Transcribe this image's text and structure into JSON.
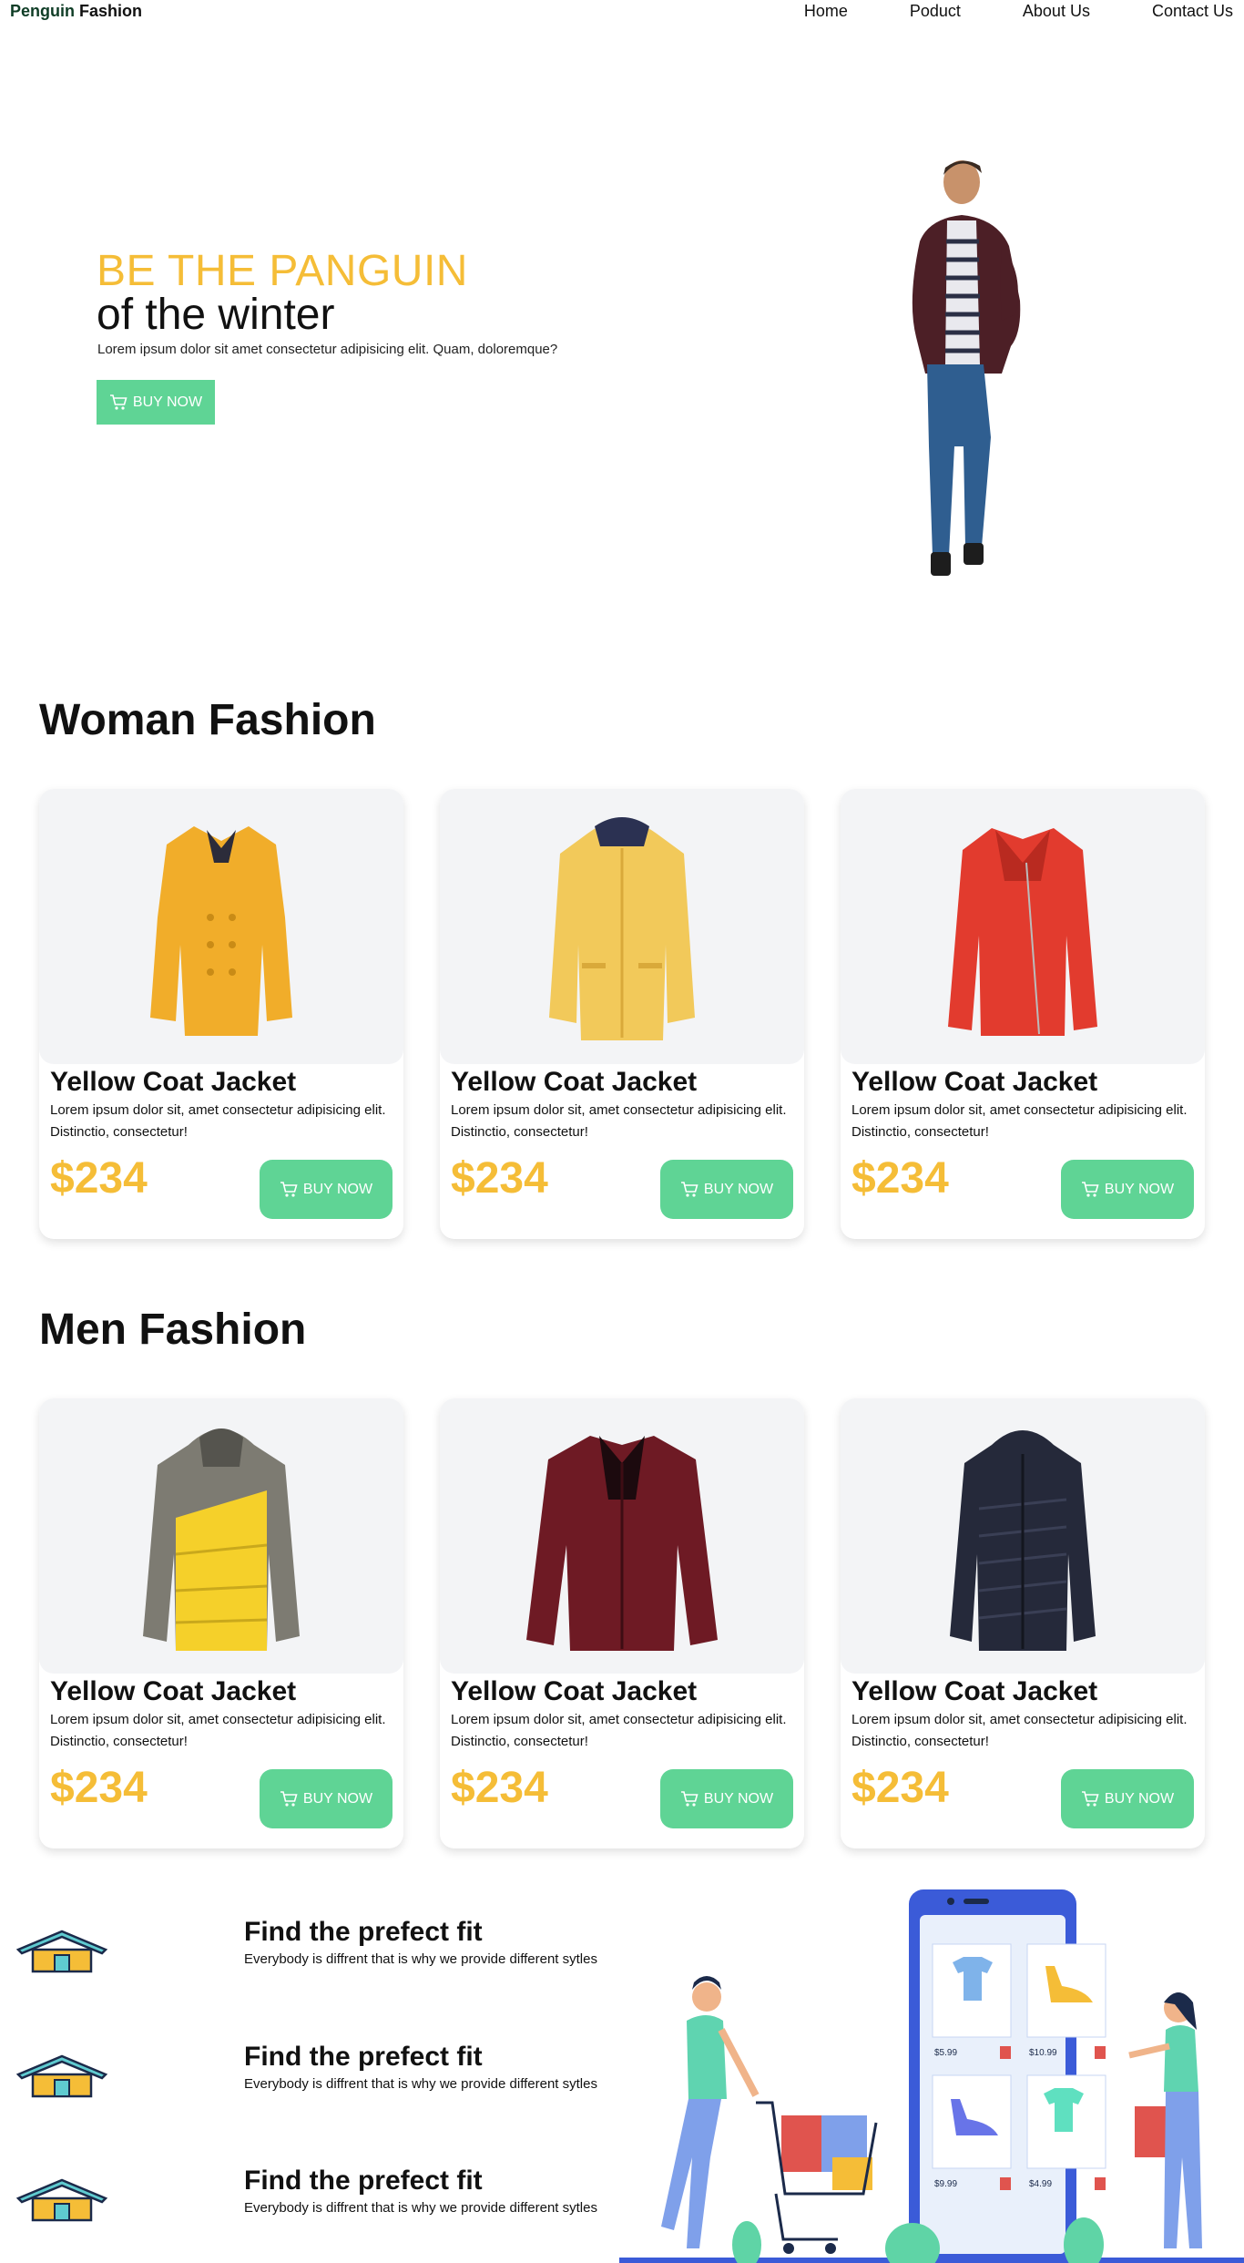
{
  "nav": {
    "brand_part1": "Penguin",
    "brand_part2": "Fashion",
    "links": [
      "Home",
      "Poduct",
      "About Us",
      "Contact Us"
    ]
  },
  "hero": {
    "title_highlight": "BE THE PANGUIN",
    "title_rest": "of the winter",
    "description": "Lorem ipsum dolor sit amet consectetur adipisicing elit. Quam, doloremque?",
    "button_label": "BUY NOW"
  },
  "woman_section": {
    "title": "Woman Fashion",
    "cards": [
      {
        "title": "Yellow Coat Jacket",
        "desc": "Lorem ipsum dolor sit, amet consectetur adipisicing elit. Distinctio, consectetur!",
        "price": "$234",
        "button": "BUY NOW"
      },
      {
        "title": "Yellow Coat Jacket",
        "desc": "Lorem ipsum dolor sit, amet consectetur adipisicing elit. Distinctio, consectetur!",
        "price": "$234",
        "button": "BUY NOW"
      },
      {
        "title": "Yellow Coat Jacket",
        "desc": "Lorem ipsum dolor sit, amet consectetur adipisicing elit. Distinctio, consectetur!",
        "price": "$234",
        "button": "BUY NOW"
      }
    ]
  },
  "men_section": {
    "title": "Men Fashion",
    "cards": [
      {
        "title": "Yellow Coat Jacket",
        "desc": "Lorem ipsum dolor sit, amet consectetur adipisicing elit. Distinctio, consectetur!",
        "price": "$234",
        "button": "BUY NOW"
      },
      {
        "title": "Yellow Coat Jacket",
        "desc": "Lorem ipsum dolor sit, amet consectetur adipisicing elit. Distinctio, consectetur!",
        "price": "$234",
        "button": "BUY NOW"
      },
      {
        "title": "Yellow Coat Jacket",
        "desc": "Lorem ipsum dolor sit, amet consectetur adipisicing elit. Distinctio, consectetur!",
        "price": "$234",
        "button": "BUY NOW"
      }
    ]
  },
  "features": [
    {
      "title": "Find the prefect fit",
      "subtitle": "Everybody is diffrent that is why we provide different sytles"
    },
    {
      "title": "Find the prefect fit",
      "subtitle": "Everybody is diffrent that is why we provide different sytles"
    },
    {
      "title": "Find the prefect fit",
      "subtitle": "Everybody is diffrent that is why we provide different sytles"
    }
  ],
  "illustration": {
    "prices": [
      "$5.99",
      "$10.99",
      "$9.99",
      "$4.99"
    ]
  },
  "colors": {
    "accent_yellow": "#f5bd37",
    "button_green": "#5fd495",
    "brand_dark_green": "#0f3d26"
  }
}
